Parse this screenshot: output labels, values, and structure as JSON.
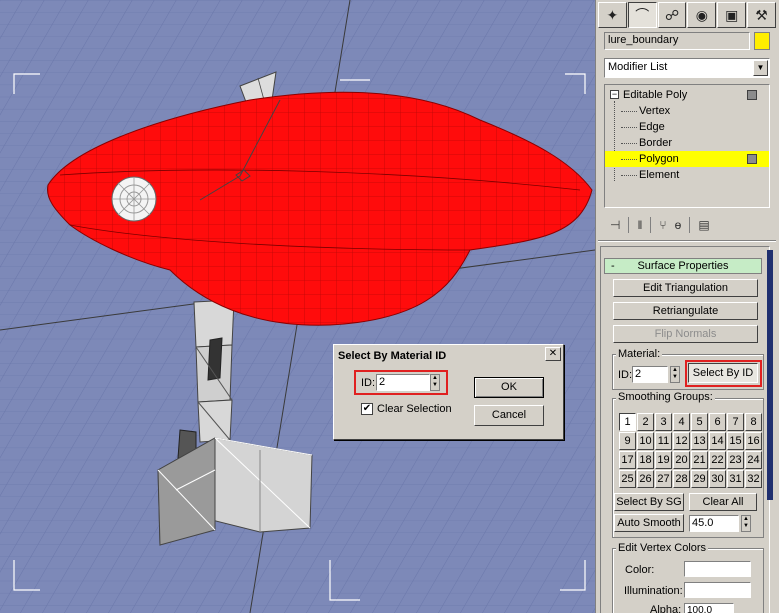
{
  "command_panel": {
    "tabs": [
      {
        "icon": "create-icon",
        "glyph": "✦"
      },
      {
        "icon": "modify-icon",
        "glyph": "⌒"
      },
      {
        "icon": "hierarchy-icon",
        "glyph": "☍"
      },
      {
        "icon": "motion-icon",
        "glyph": "◉"
      },
      {
        "icon": "display-icon",
        "glyph": "▣"
      },
      {
        "icon": "utilities-icon",
        "glyph": "⚒"
      }
    ],
    "object_name": "lure_boundary",
    "object_color": "#ffee00",
    "modifier_list": "Modifier List",
    "stack": {
      "root": "Editable Poly",
      "sub_objects": [
        "Vertex",
        "Edge",
        "Border",
        "Polygon",
        "Element"
      ],
      "selected": "Polygon"
    }
  },
  "surface_properties": {
    "title": "Surface Properties",
    "collapse_glyph": "-",
    "edit_triangulation": "Edit Triangulation",
    "retriangulate": "Retriangulate",
    "flip_normals": "Flip Normals",
    "material": {
      "group_label": "Material:",
      "id_label": "ID:",
      "id_value": "2",
      "select_by_id": "Select By ID"
    },
    "smoothing_groups": {
      "group_label": "Smoothing Groups:",
      "numbers": [
        "1",
        "2",
        "3",
        "4",
        "5",
        "6",
        "7",
        "8",
        "9",
        "10",
        "11",
        "12",
        "13",
        "14",
        "15",
        "16",
        "17",
        "18",
        "19",
        "20",
        "21",
        "22",
        "23",
        "24",
        "25",
        "26",
        "27",
        "28",
        "29",
        "30",
        "31",
        "32"
      ],
      "active": "1",
      "select_by_sg": "Select By SG",
      "clear_all": "Clear All",
      "auto_smooth": "Auto Smooth",
      "auto_smooth_value": "45.0"
    }
  },
  "edit_vertex_colors": {
    "title": "Edit Vertex Colors",
    "color_label": "Color:",
    "illumination_label": "Illumination:",
    "alpha_label": "Alpha:",
    "alpha_value": "100.0"
  },
  "dialog": {
    "title": "Select By Material ID",
    "id_label": "ID:",
    "id_value": "2",
    "clear_selection_label": "Clear Selection",
    "clear_selection_checked": true,
    "ok": "OK",
    "cancel": "Cancel"
  },
  "colors": {
    "viewport_bg": "#7d89b8",
    "lure_body": "#ff0c0c",
    "highlight": "#e02020"
  }
}
